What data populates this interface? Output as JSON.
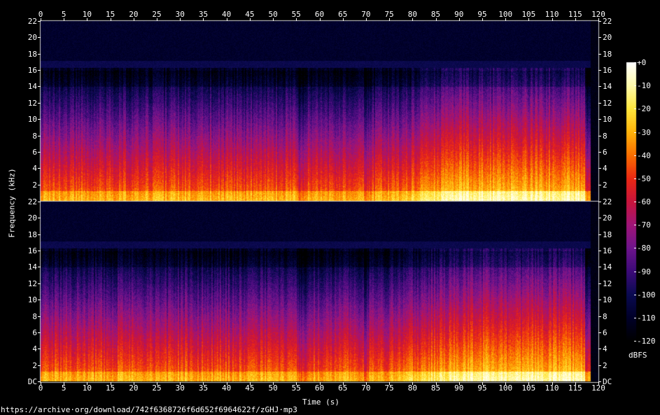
{
  "chart_data": {
    "type": "heatmap",
    "description_channels": [
      "upper channel",
      "lower channel"
    ],
    "x_axis": {
      "label": "Time (s)",
      "range": [
        0,
        120
      ],
      "ticks": [
        "0",
        "5",
        "10",
        "15",
        "20",
        "25",
        "30",
        "35",
        "40",
        "45",
        "50",
        "55",
        "60",
        "65",
        "70",
        "75",
        "80",
        "85",
        "90",
        "95",
        "100",
        "105",
        "110",
        "115",
        "120"
      ]
    },
    "y_axis": {
      "label": "Frequency (kHz)",
      "range": [
        0,
        22
      ],
      "ticks_top": [
        "22",
        "20",
        "18",
        "16",
        "14",
        "12",
        "10",
        "8",
        "6",
        "4",
        "2"
      ],
      "ticks_bottom": [
        "22",
        "20",
        "18",
        "16",
        "14",
        "12",
        "10",
        "8",
        "6",
        "4",
        "2",
        "DC"
      ]
    },
    "colorbar": {
      "label": "dBFS",
      "range": [
        -120,
        0
      ],
      "ticks": [
        "+0",
        "-10",
        "-20",
        "-30",
        "-40",
        "-50",
        "-60",
        "-70",
        "-80",
        "-90",
        "-100",
        "-110",
        "-120"
      ]
    },
    "signal": {
      "lowpass_cutoff_khz": 16,
      "audio_end_s": 117,
      "intensity_rises_after_s": 75
    }
  },
  "footer": {
    "url": "https://archive·org/download/742f6368726f6d652f6964622f/zGHJ·mp3"
  }
}
